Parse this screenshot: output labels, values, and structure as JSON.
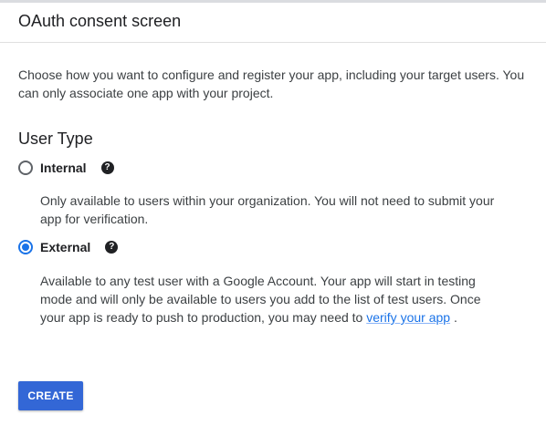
{
  "header": {
    "title": "OAuth consent screen"
  },
  "intro": {
    "text": "Choose how you want to configure and register your app, including your target users. You can only associate one app with your project."
  },
  "user_type": {
    "title": "User Type",
    "options": [
      {
        "label": "Internal",
        "selected": false,
        "help_icon": "help-circle-icon",
        "description": "Only available to users within your organization. You will not need to submit your app for verification."
      },
      {
        "label": "External",
        "selected": true,
        "help_icon": "help-circle-icon",
        "description": "Available to any test user with a Google Account. Your app will start in testing mode and will only be available to users you add to the list of test users. Once your app is ready to push to production, you may need to",
        "link_text": "verify your app",
        "after_link": " ."
      }
    ]
  },
  "actions": {
    "create_label": "CREATE"
  },
  "colors": {
    "accent": "#1a73e8",
    "button": "#3367d6",
    "text": "#202124"
  }
}
